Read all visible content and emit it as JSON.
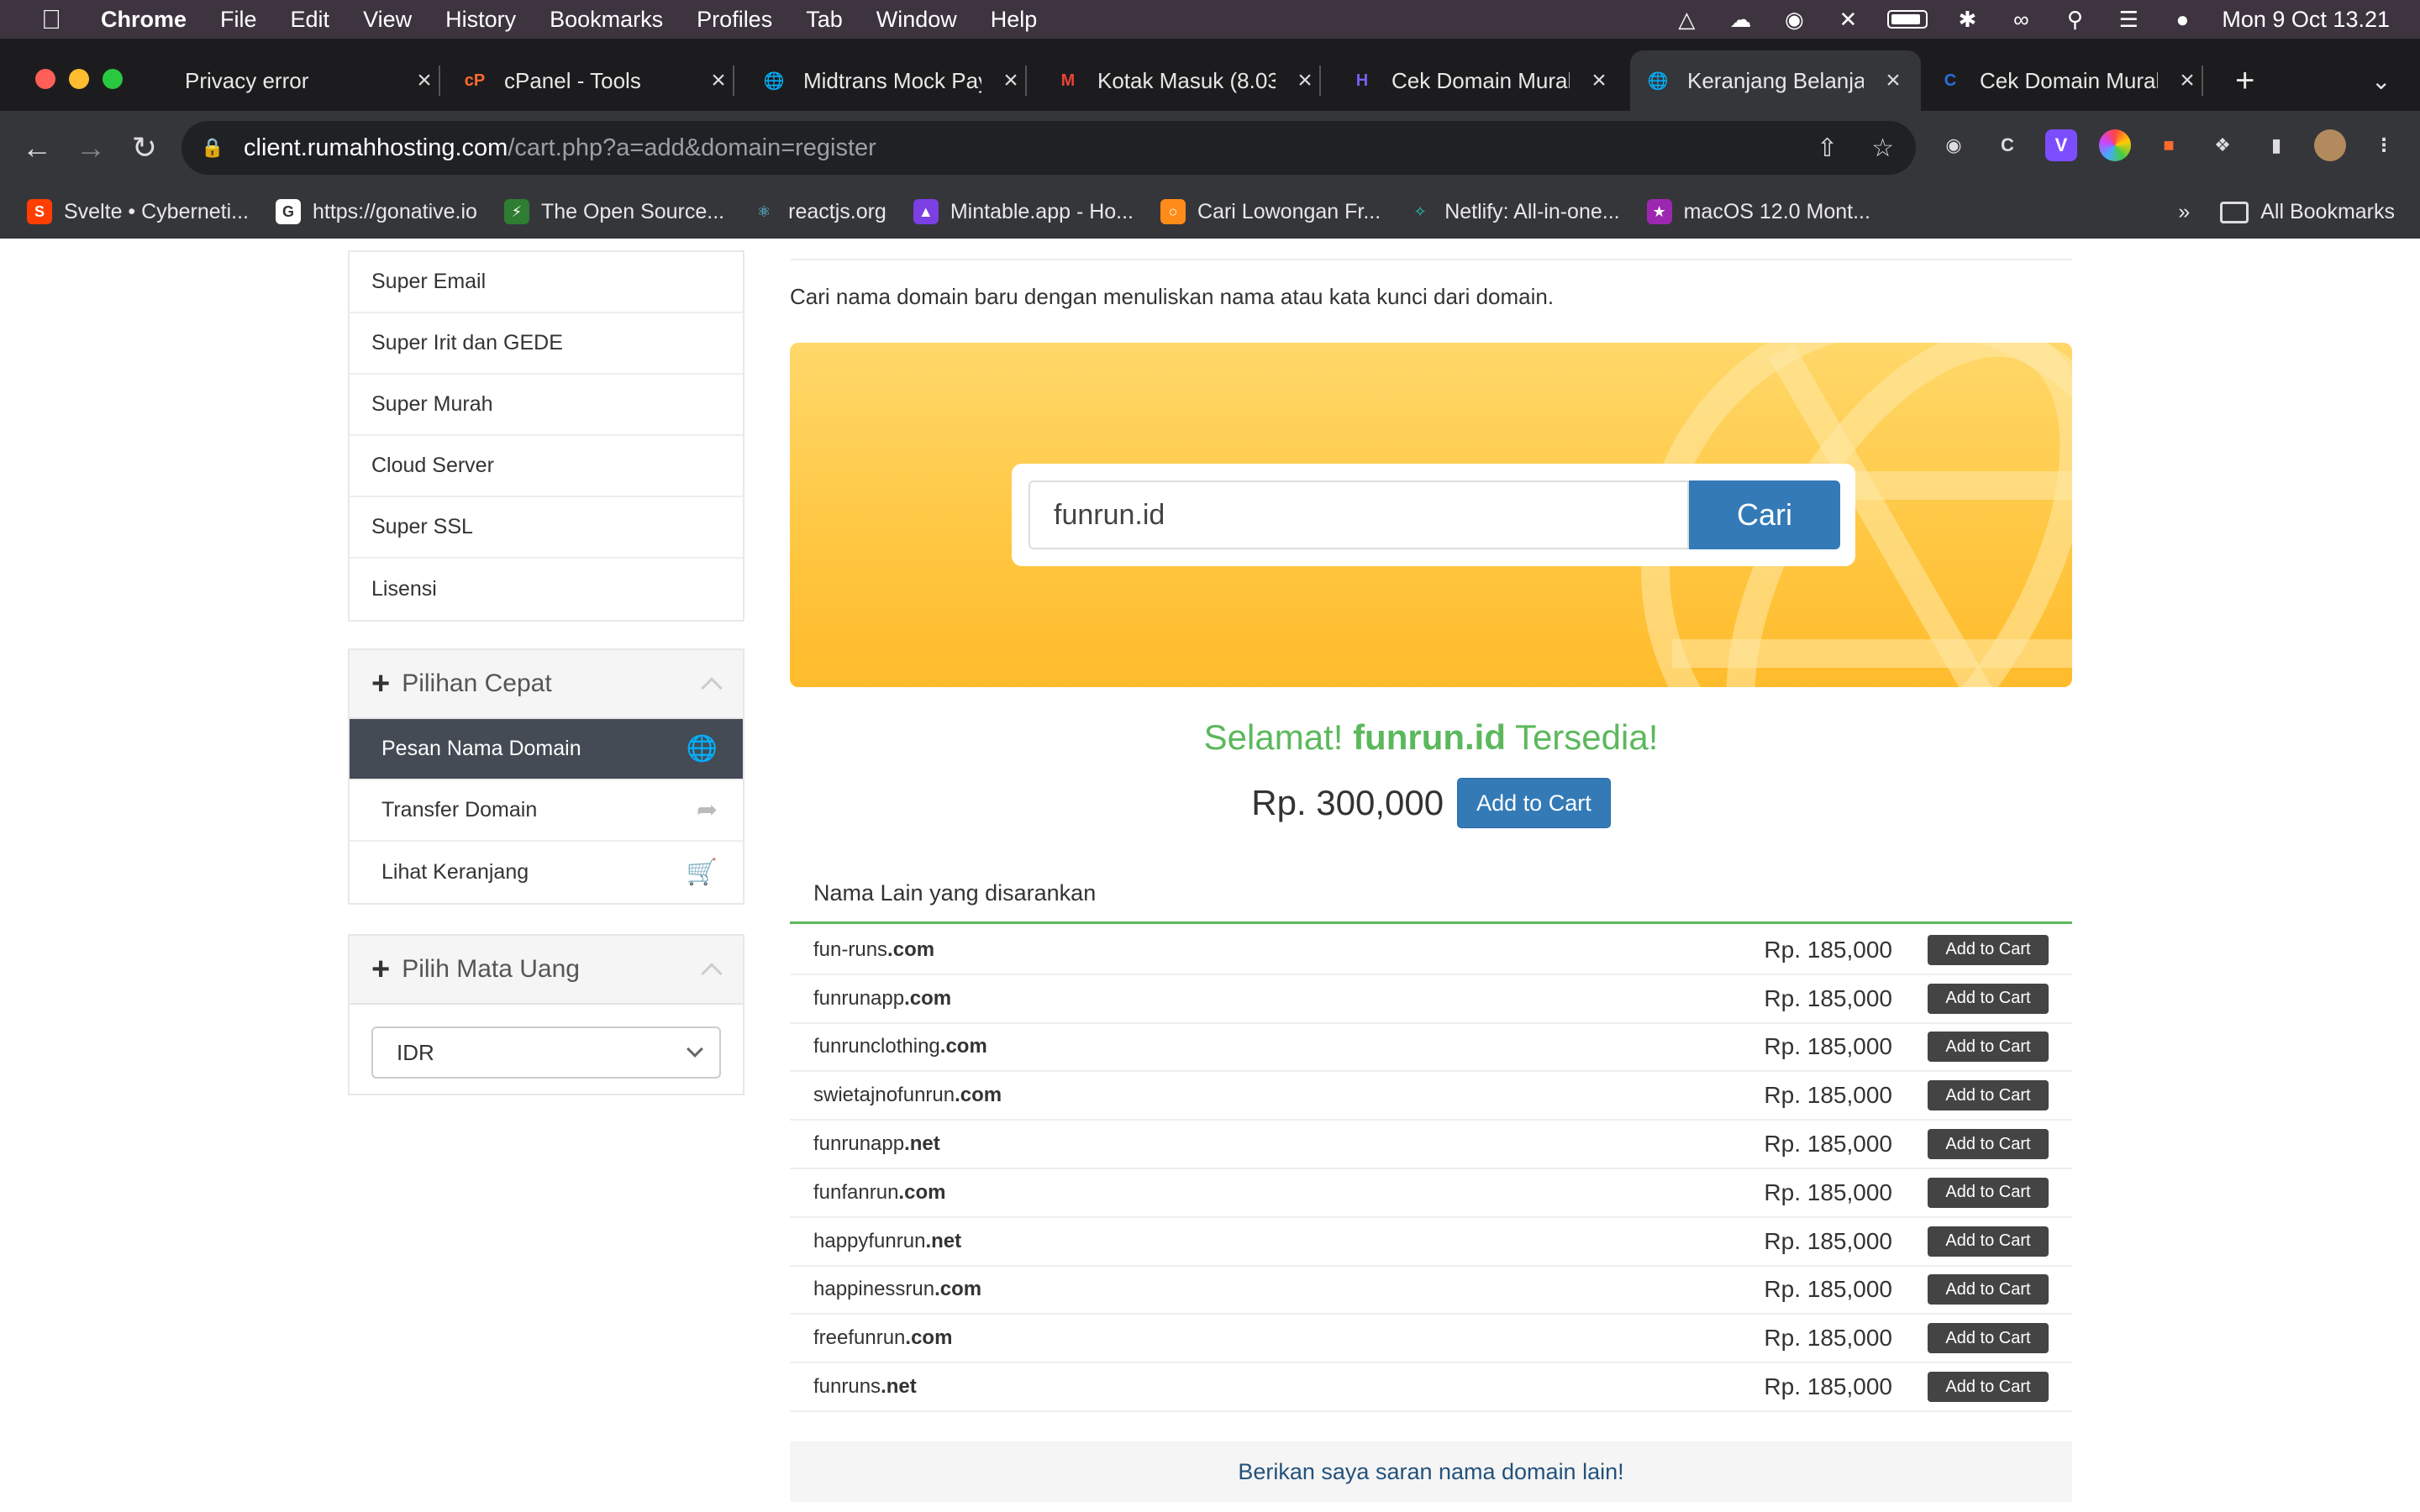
{
  "menubar": {
    "app": "Chrome",
    "items": [
      "File",
      "Edit",
      "View",
      "History",
      "Bookmarks",
      "Profiles",
      "Tab",
      "Window",
      "Help"
    ],
    "clock": "Mon 9 Oct  13.21"
  },
  "tabs": [
    {
      "title": "Privacy error",
      "favicon": "privacy-error-icon",
      "color": "#1c1c1e"
    },
    {
      "title": "cPanel - Tools",
      "favicon": "cpanel-icon",
      "color": "#ff6c2c"
    },
    {
      "title": "Midtrans Mock Pay",
      "favicon": "globe-icon",
      "color": "#5f6368"
    },
    {
      "title": "Kotak Masuk (8.03",
      "favicon": "gmail-icon",
      "color": "#ffffff"
    },
    {
      "title": "Cek Domain Murah",
      "favicon": "h-logo-icon",
      "color": "#6b4fe0"
    },
    {
      "title": "Keranjang Belanja",
      "favicon": "globe-icon",
      "color": "#5f6368"
    },
    {
      "title": "Cek Domain Murah",
      "favicon": "c-logo-icon",
      "color": "#2c6fe0"
    }
  ],
  "toolbar": {
    "url_host": "client.rumahhosting.com",
    "url_path": "/cart.php?a=add&domain=register"
  },
  "bookmarks": [
    {
      "label": "Svelte • Cyberneti...",
      "color": "#ff3e00"
    },
    {
      "label": "https://gonative.io",
      "color": "#ffffff"
    },
    {
      "label": "The Open Source...",
      "color": "#2e7d32"
    },
    {
      "label": "reactjs.org",
      "color": "#61dafb"
    },
    {
      "label": "Mintable.app - Ho...",
      "color": "#7b3fe4"
    },
    {
      "label": "Cari Lowongan Fr...",
      "color": "#ff8c1a"
    },
    {
      "label": "Netlify: All-in-one...",
      "color": "#25c7b7"
    },
    {
      "label": "macOS 12.0 Mont...",
      "color": "#9c27b0"
    }
  ],
  "bookmarks_overflow": "»",
  "all_bookmarks": "All Bookmarks",
  "sidebar": {
    "categories": [
      "Super Email",
      "Super Irit dan GEDE",
      "Super Murah",
      "Cloud Server",
      "Super SSL",
      "Lisensi"
    ],
    "quick_title": "Pilihan Cepat",
    "quick_items": [
      {
        "label": "Pesan Nama Domain",
        "icon": "globe-icon",
        "active": true
      },
      {
        "label": "Transfer Domain",
        "icon": "share-icon",
        "active": false
      },
      {
        "label": "Lihat Keranjang",
        "icon": "cart-icon",
        "active": false
      }
    ],
    "currency_title": "Pilih Mata Uang",
    "currency_value": "IDR"
  },
  "main": {
    "intro": "Cari nama domain baru dengan menuliskan nama atau kata kunci dari domain.",
    "search_value": "funrun.id",
    "search_button": "Cari",
    "congrats_prefix": "Selamat!",
    "congrats_domain": "funrun.id",
    "congrats_suffix": "Tersedia!",
    "price": "Rp. 300,000",
    "add_to_cart": "Add to Cart",
    "suggest_title": "Nama Lain yang disarankan",
    "suggestions": [
      {
        "name": "fun-runs",
        "tld": ".com",
        "price": "Rp. 185,000",
        "button": "Add to Cart"
      },
      {
        "name": "funrunapp",
        "tld": ".com",
        "price": "Rp. 185,000",
        "button": "Add to Cart"
      },
      {
        "name": "funrunclothing",
        "tld": ".com",
        "price": "Rp. 185,000",
        "button": "Add to Cart"
      },
      {
        "name": "swietajnofunrun",
        "tld": ".com",
        "price": "Rp. 185,000",
        "button": "Add to Cart"
      },
      {
        "name": "funrunapp",
        "tld": ".net",
        "price": "Rp. 185,000",
        "button": "Add to Cart"
      },
      {
        "name": "funfanrun",
        "tld": ".com",
        "price": "Rp. 185,000",
        "button": "Add to Cart"
      },
      {
        "name": "happyfunrun",
        "tld": ".net",
        "price": "Rp. 185,000",
        "button": "Add to Cart"
      },
      {
        "name": "happinessrun",
        "tld": ".com",
        "price": "Rp. 185,000",
        "button": "Add to Cart"
      },
      {
        "name": "freefunrun",
        "tld": ".com",
        "price": "Rp. 185,000",
        "button": "Add to Cart"
      },
      {
        "name": "funruns",
        "tld": ".net",
        "price": "Rp. 185,000",
        "button": "Add to Cart"
      }
    ],
    "more_link": "Berikan saya saran nama domain lain!"
  },
  "colors": {
    "primary": "#337ab7",
    "success": "#5cb85c",
    "sidebar_active": "#444b55"
  }
}
